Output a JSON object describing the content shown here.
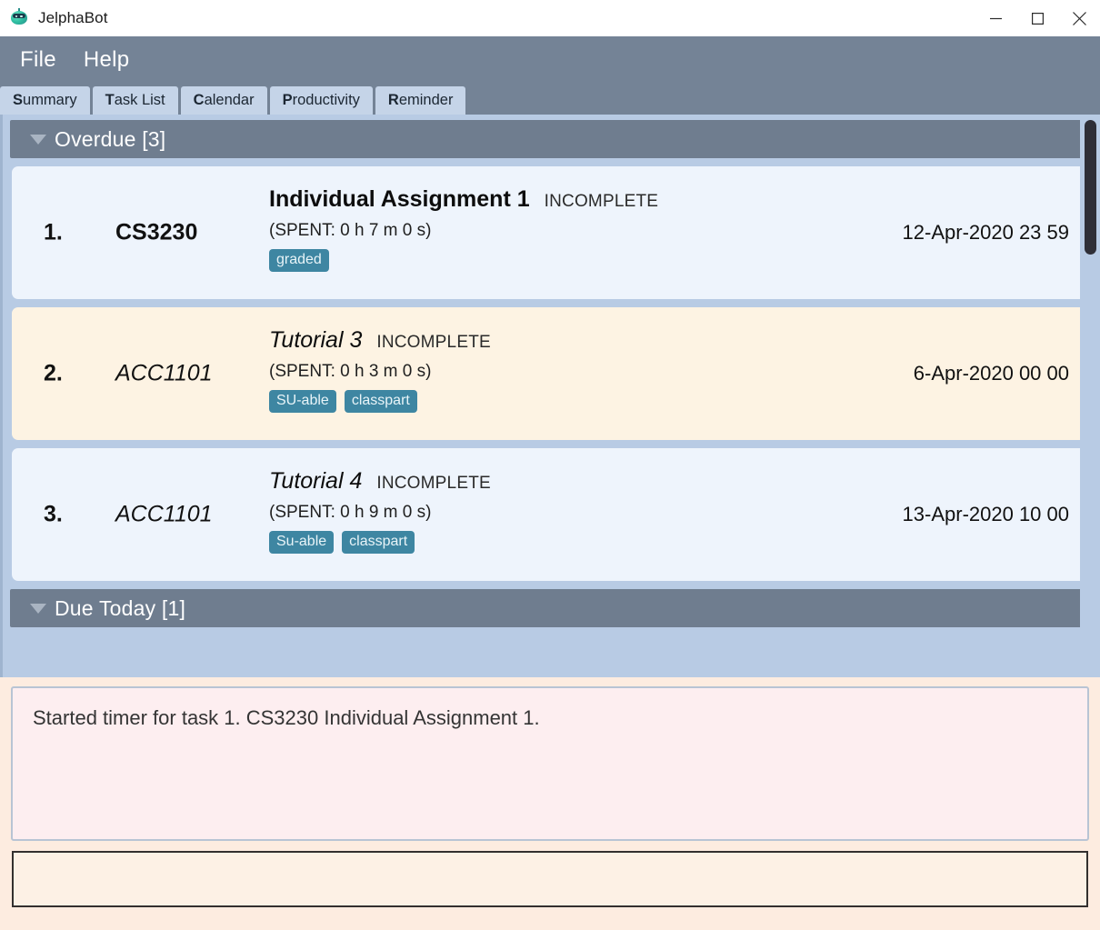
{
  "window": {
    "title": "JelphaBot",
    "app_icon": "robot-head-icon",
    "controls": {
      "minimize": "minimize-icon",
      "maximize": "maximize-icon",
      "close": "close-icon"
    }
  },
  "menubar": {
    "items": [
      {
        "label": "File",
        "mnemonic": "F"
      },
      {
        "label": "Help",
        "mnemonic": "H"
      }
    ]
  },
  "tabs": [
    {
      "mnemonic": "S",
      "rest": "ummary",
      "label": "Summary",
      "selected": true
    },
    {
      "mnemonic": "T",
      "rest": "ask List",
      "label": "Task List",
      "selected": false
    },
    {
      "mnemonic": "C",
      "rest": "alendar",
      "label": "Calendar",
      "selected": false
    },
    {
      "mnemonic": "P",
      "rest": "roductivity",
      "label": "Productivity",
      "selected": false
    },
    {
      "mnemonic": "R",
      "rest": "eminder",
      "label": "Reminder",
      "selected": false
    }
  ],
  "sections": [
    {
      "title": "Overdue [3]",
      "caret": "chevron-down-icon",
      "expanded": true
    },
    {
      "title": "Due Today [1]",
      "caret": "chevron-down-icon",
      "expanded": true
    }
  ],
  "tasks": [
    {
      "index": "1.",
      "module": "CS3230",
      "name": "Individual Assignment 1",
      "status": "INCOMPLETE",
      "spent": "(SPENT: 0 h 7 m 0 s)",
      "tags": [
        "graded"
      ],
      "due": "12-Apr-2020 23 59",
      "style": "blue",
      "emphasis": "bold"
    },
    {
      "index": "2.",
      "module": "ACC1101",
      "name": "Tutorial 3",
      "status": "INCOMPLETE",
      "spent": "(SPENT: 0 h 3 m 0 s)",
      "tags": [
        "SU-able",
        "classpart"
      ],
      "due": "6-Apr-2020 00 00",
      "style": "cream",
      "emphasis": "italic"
    },
    {
      "index": "3.",
      "module": "ACC1101",
      "name": "Tutorial 4",
      "status": "INCOMPLETE",
      "spent": "(SPENT: 0 h 9 m 0 s)",
      "tags": [
        "Su-able",
        "classpart"
      ],
      "due": "13-Apr-2020 10 00",
      "style": "blue",
      "emphasis": "italic"
    }
  ],
  "feedback": {
    "message": "Started timer for task 1. CS3230 Individual Assignment 1."
  },
  "command": {
    "value": "",
    "placeholder": ""
  },
  "colors": {
    "menubar": "#748396",
    "tab": "#c5d4e8",
    "panel": "#b8cbe4",
    "section_header": "#6f7d8f",
    "card_blue": "#eef4fc",
    "card_cream": "#fdf3e3",
    "tag": "#3e86a2",
    "feedback_bg": "#fdeef0",
    "page_bg": "#fdece0",
    "scrollbar_thumb": "#2f2f37"
  }
}
